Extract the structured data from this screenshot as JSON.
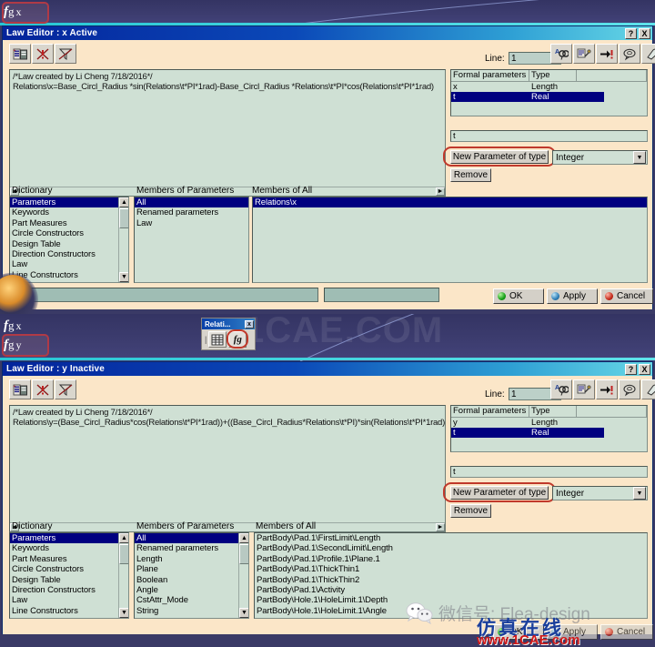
{
  "watermarks": {
    "cae_band": "1CAE.COM",
    "wechat_label": "微信号: Flea-design",
    "cn_brand": "仿真在线",
    "url": "www.1CAE.com"
  },
  "tree": {
    "item_x": {
      "fg": "f",
      "sub": "g",
      "var": "x"
    },
    "item_x2": {
      "fg": "f",
      "sub": "g",
      "var": "x"
    },
    "item_y": {
      "fg": "f",
      "sub": "g",
      "var": "y"
    }
  },
  "mini_toolbar": {
    "title": "Relati...",
    "close_label": "x",
    "icons": [
      "table-icon",
      "fg-formula-icon"
    ]
  },
  "window_x": {
    "title": "Law Editor : x Active",
    "help_label": "?",
    "close_label": "X",
    "toolbar_left": [
      "add-parameter-icon",
      "delete-error-icon",
      "filter-icon"
    ],
    "line_label": "Line:",
    "line_value": "1",
    "toolbar_right": [
      "find-icon",
      "replace-icon",
      "goto-line-icon",
      "comment-icon",
      "erase-icon"
    ],
    "code": [
      "/*Law created by Li Cheng 7/18/2016*/",
      "Relations\\x=Base_Circl_Radius *sin(Relations\\t*PI*1rad)-Base_Circl_Radius *Relations\\t*PI*cos(Relations\\t*PI*1rad)"
    ],
    "formal_parameters": {
      "headers": [
        "Formal parameters",
        "Type",
        ""
      ],
      "rows": [
        {
          "name": "x",
          "type": "Length",
          "selected": false
        },
        {
          "name": "t",
          "type": "Real",
          "selected": true
        }
      ]
    },
    "param_field_value": "t",
    "new_param_button": "New Parameter of type",
    "type_combo_value": "Integer",
    "remove_button": "Remove",
    "dictionary_label": "Dictionary",
    "dictionary_items": [
      "Parameters",
      "Keywords",
      "Part Measures",
      "Circle Constructors",
      "Design Table",
      "Direction Constructors",
      "Law",
      "Line Constructors"
    ],
    "dictionary_selected": 0,
    "members_params_label": "Members of Parameters",
    "members_params_items": [
      "All",
      "Renamed parameters",
      "Law"
    ],
    "members_params_selected": 0,
    "members_all_label": "Members of All",
    "members_all_items": [
      "Relations\\x"
    ],
    "members_all_selected": 0,
    "bottom_field_1": "",
    "bottom_field_2": "",
    "buttons": {
      "ok": "OK",
      "apply": "Apply",
      "cancel": "Cancel"
    }
  },
  "window_y": {
    "title": "Law Editor : y Inactive",
    "help_label": "?",
    "close_label": "X",
    "toolbar_left": [
      "add-parameter-icon",
      "delete-error-icon",
      "filter-icon"
    ],
    "line_label": "Line:",
    "line_value": "1",
    "toolbar_right": [
      "find-icon",
      "replace-icon",
      "goto-line-icon",
      "comment-icon",
      "erase-icon"
    ],
    "code": [
      "/*Law created by Li Cheng 7/18/2016*/",
      "Relations\\y=(Base_Circl_Radius*cos(Relations\\t*PI*1rad))+((Base_Circl_Radius*Relations\\t*PI)*sin(Relations\\t*PI*1rad)"
    ],
    "formal_parameters": {
      "headers": [
        "Formal parameters",
        "Type",
        ""
      ],
      "rows": [
        {
          "name": "y",
          "type": "Length",
          "selected": false
        },
        {
          "name": "t",
          "type": "Real",
          "selected": true
        }
      ]
    },
    "param_field_value": "t",
    "new_param_button": "New Parameter of type",
    "type_combo_value": "Integer",
    "remove_button": "Remove",
    "dictionary_label": "Dictionary",
    "dictionary_items": [
      "Parameters",
      "Keywords",
      "Part Measures",
      "Circle Constructors",
      "Design Table",
      "Direction Constructors",
      "Law",
      "Line Constructors"
    ],
    "dictionary_selected": 0,
    "members_params_label": "Members of Parameters",
    "members_params_items": [
      "All",
      "Renamed parameters",
      "Length",
      "Plane",
      "Boolean",
      "Angle",
      "CstAttr_Mode",
      "String"
    ],
    "members_params_selected": 0,
    "members_all_label": "Members of All",
    "members_all_items": [
      "PartBody\\Pad.1\\FirstLimit\\Length",
      "PartBody\\Pad.1\\SecondLimit\\Length",
      "PartBody\\Pad.1\\Profile.1\\Plane.1",
      "PartBody\\Pad.1\\ThickThin1",
      "PartBody\\Pad.1\\ThickThin2",
      "PartBody\\Pad.1\\Activity",
      "PartBody\\Hole.1\\HoleLimit.1\\Depth",
      "PartBody\\Hole.1\\HoleLimit.1\\Angle"
    ],
    "members_all_selected": -1,
    "buttons": {
      "ok": "OK",
      "apply": "Apply",
      "cancel": "Cancel"
    }
  }
}
